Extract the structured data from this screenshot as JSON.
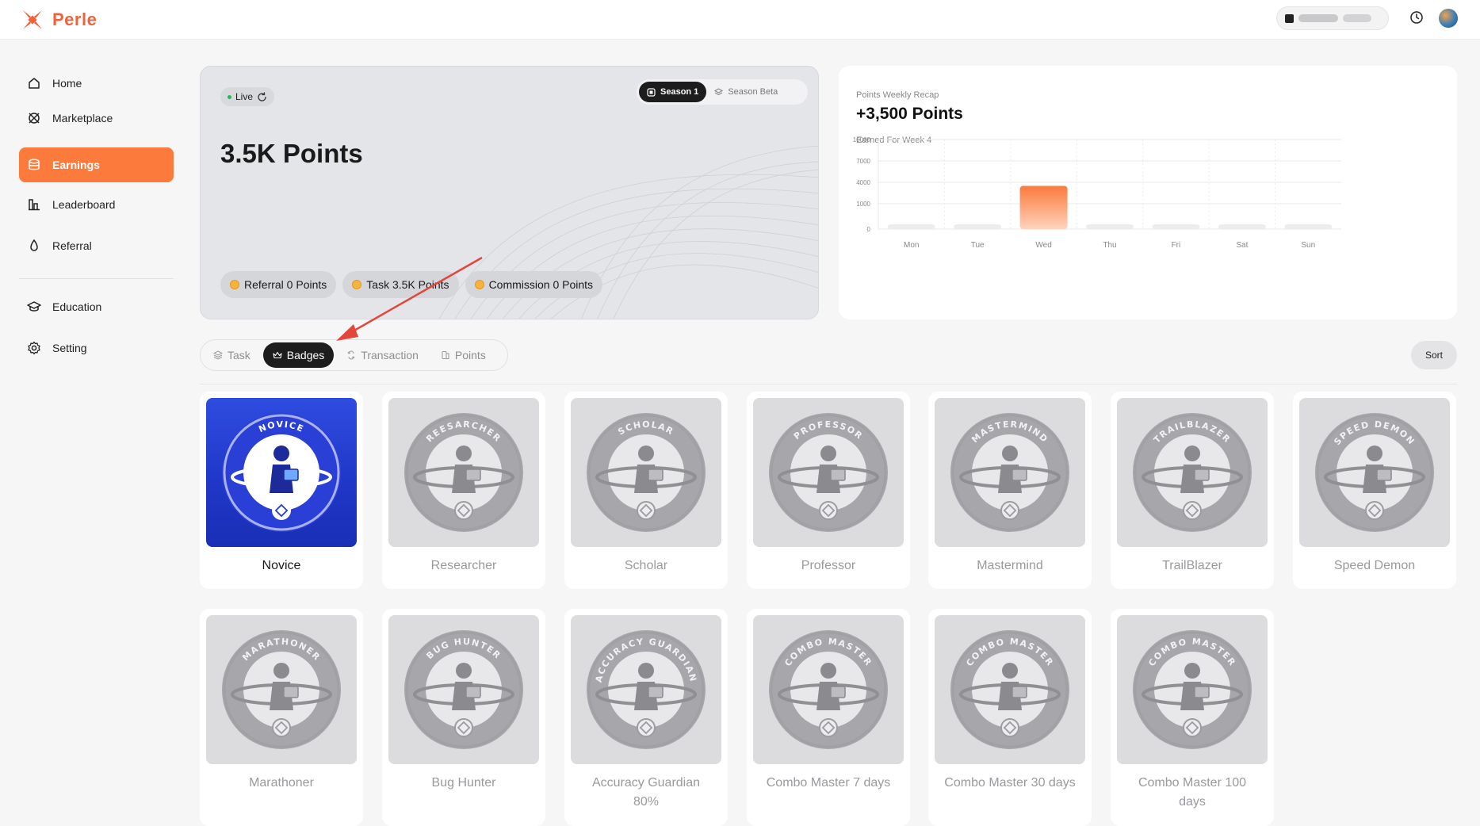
{
  "app": {
    "brand": "Perle"
  },
  "header": {
    "wallet_icon": "wallet-icon",
    "history_icon": "clock-icon"
  },
  "sidebar": {
    "items": [
      {
        "label": "Home",
        "icon": "home-icon"
      },
      {
        "label": "Marketplace",
        "icon": "marketplace-icon"
      },
      {
        "label": "Earnings",
        "icon": "earnings-icon",
        "active": true
      },
      {
        "label": "Leaderboard",
        "icon": "leaderboard-icon"
      },
      {
        "label": "Referral",
        "icon": "referral-icon"
      },
      {
        "label": "Education",
        "icon": "education-icon"
      },
      {
        "label": "Setting",
        "icon": "gear-icon"
      }
    ]
  },
  "points_card": {
    "live_label": "Live",
    "season_selected": "Season 1",
    "season_other": "Season Beta",
    "total": "3.5K Points",
    "chips": {
      "referral": "Referral 0 Points",
      "task": "Task 3.5K Points",
      "commission": "Commission 0 Points"
    }
  },
  "weekly_recap": {
    "subtitle": "Points Weekly Recap",
    "total": "+3,500 Points",
    "period": "Earned For Week 4"
  },
  "chart_data": {
    "type": "bar",
    "title": "Points Weekly Recap",
    "categories": [
      "Mon",
      "Tue",
      "Wed",
      "Thu",
      "Fri",
      "Sat",
      "Sun"
    ],
    "values": [
      0,
      0,
      3500,
      0,
      0,
      0,
      0
    ],
    "ytick_values": [
      0,
      1000,
      4000,
      7000,
      10000
    ],
    "ytick_labels": [
      "0",
      "1000",
      "4000",
      "7000",
      "10000"
    ],
    "ylim": [
      0,
      10000
    ],
    "grid": true,
    "highlight_color": "#fb7a3c"
  },
  "tabs": {
    "items": [
      {
        "label": "Task",
        "icon": "task-icon"
      },
      {
        "label": "Badges",
        "icon": "crown-icon",
        "active": true
      },
      {
        "label": "Transaction",
        "icon": "transaction-icon"
      },
      {
        "label": "Points",
        "icon": "points-icon"
      }
    ],
    "sort_label": "Sort"
  },
  "badges": [
    {
      "name": "Novice",
      "ring": "NOVICE",
      "earned": true
    },
    {
      "name": "Researcher",
      "ring": "REESARCHER",
      "earned": false
    },
    {
      "name": "Scholar",
      "ring": "SCHOLAR",
      "earned": false
    },
    {
      "name": "Professor",
      "ring": "PROFESSOR",
      "earned": false
    },
    {
      "name": "Mastermind",
      "ring": "MASTERMIND",
      "earned": false
    },
    {
      "name": "TrailBlazer",
      "ring": "TRAILBLAZER",
      "earned": false
    },
    {
      "name": "Speed Demon",
      "ring": "SPEED DEMON",
      "earned": false
    },
    {
      "name": "Marathoner",
      "ring": "MARATHONER",
      "earned": false
    },
    {
      "name": "Bug Hunter",
      "ring": "BUG HUNTER",
      "earned": false
    },
    {
      "name": "Accuracy Guardian 80%",
      "ring": "ACCURACY GUARDIAN",
      "earned": false
    },
    {
      "name": "Combo Master 7 days",
      "ring": "COMBO MASTER",
      "earned": false
    },
    {
      "name": "Combo Master 30 days",
      "ring": "COMBO MASTER",
      "earned": false
    },
    {
      "name": "Combo Master 100 days",
      "ring": "COMBO MASTER",
      "earned": false
    }
  ],
  "colors": {
    "accent": "#fb7a3c",
    "brand": "#f2623a",
    "dark_pill": "#1d1d1d",
    "badge_earned": "#2f4ce0",
    "annotation_arrow": "#e5463a"
  }
}
